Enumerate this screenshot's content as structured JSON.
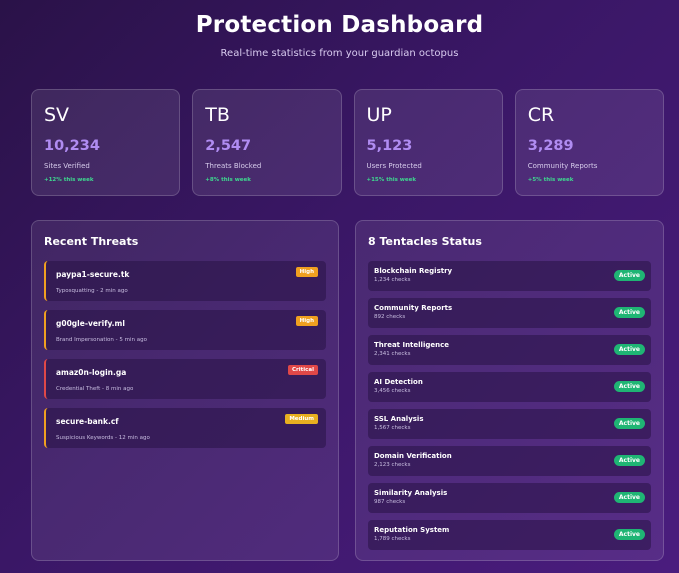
{
  "header": {
    "title": "Protection Dashboard",
    "subtitle": "Real-time statistics from your guardian octopus"
  },
  "stats": [
    {
      "abbr": "SV",
      "value": "10,234",
      "label": "Sites Verified",
      "change": "+12% this week"
    },
    {
      "abbr": "TB",
      "value": "2,547",
      "label": "Threats Blocked",
      "change": "+8% this week"
    },
    {
      "abbr": "UP",
      "value": "5,123",
      "label": "Users Protected",
      "change": "+15% this week"
    },
    {
      "abbr": "CR",
      "value": "3,289",
      "label": "Community Reports",
      "change": "+5% this week"
    }
  ],
  "threats": {
    "title": "Recent Threats",
    "items": [
      {
        "name": "paypa1-secure.tk",
        "desc": "Typosquatting - 2 min ago",
        "severity": "High"
      },
      {
        "name": "g00gle-verify.ml",
        "desc": "Brand Impersonation - 5 min ago",
        "severity": "High"
      },
      {
        "name": "amaz0n-login.ga",
        "desc": "Credential Theft - 8 min ago",
        "severity": "Critical"
      },
      {
        "name": "secure-bank.cf",
        "desc": "Suspicious Keywords - 12 min ago",
        "severity": "Medium"
      }
    ]
  },
  "tentacles": {
    "title": "8 Tentacles Status",
    "items": [
      {
        "name": "Blockchain Registry",
        "checks": "1,234 checks",
        "status": "Active"
      },
      {
        "name": "Community Reports",
        "checks": "892 checks",
        "status": "Active"
      },
      {
        "name": "Threat Intelligence",
        "checks": "2,341 checks",
        "status": "Active"
      },
      {
        "name": "AI Detection",
        "checks": "3,456 checks",
        "status": "Active"
      },
      {
        "name": "SSL Analysis",
        "checks": "1,567 checks",
        "status": "Active"
      },
      {
        "name": "Domain Verification",
        "checks": "2,123 checks",
        "status": "Active"
      },
      {
        "name": "Similarity Analysis",
        "checks": "987 checks",
        "status": "Active"
      },
      {
        "name": "Reputation System",
        "checks": "1,789 checks",
        "status": "Active"
      }
    ]
  },
  "colors": {
    "accent": "#b08cf2",
    "positive": "#3ed78f",
    "high": "#f0a020",
    "critical": "#e04848",
    "medium": "#e8b020",
    "active": "#1fb574"
  }
}
